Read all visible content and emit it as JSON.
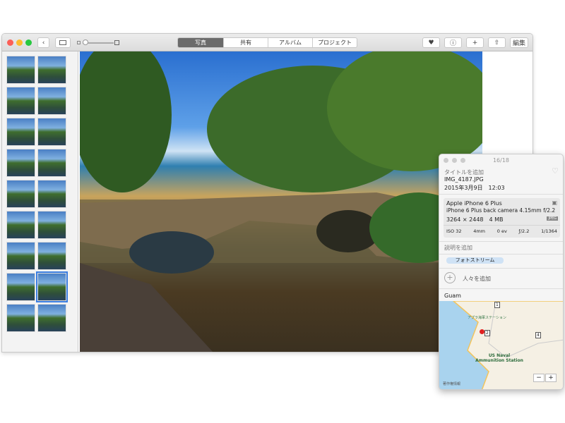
{
  "toolbar": {
    "tabs": [
      "写真",
      "共有",
      "アルバム",
      "プロジェクト"
    ],
    "active_tab": 0,
    "edit_label": "編集"
  },
  "info": {
    "counter": "16/18",
    "title_placeholder": "タイトルを追加",
    "filename": "IMG_4187.JPG",
    "datetime": "2015年3月9日　12:03",
    "camera": "Apple iPhone 6 Plus",
    "lens": "iPhone 6 Plus back camera 4.15mm f/2.2",
    "dimensions": "3264 × 2448",
    "size": "4 MB",
    "format": "JPEG",
    "exif": [
      "ISO 32",
      "4mm",
      "0 ev",
      "ƒ/2.2",
      "1/1364"
    ],
    "description_placeholder": "説明を追加",
    "album_tag": "フォトストリーム",
    "add_people": "人々を追加",
    "location": "Guam"
  },
  "map": {
    "label_station": "アプラ海軍ステーション",
    "label_ammo": "US Naval Ammunition Station",
    "routes": [
      "1",
      "2",
      "4"
    ],
    "legal": "著作権情報",
    "zoom_out": "−",
    "zoom_in": "+"
  }
}
